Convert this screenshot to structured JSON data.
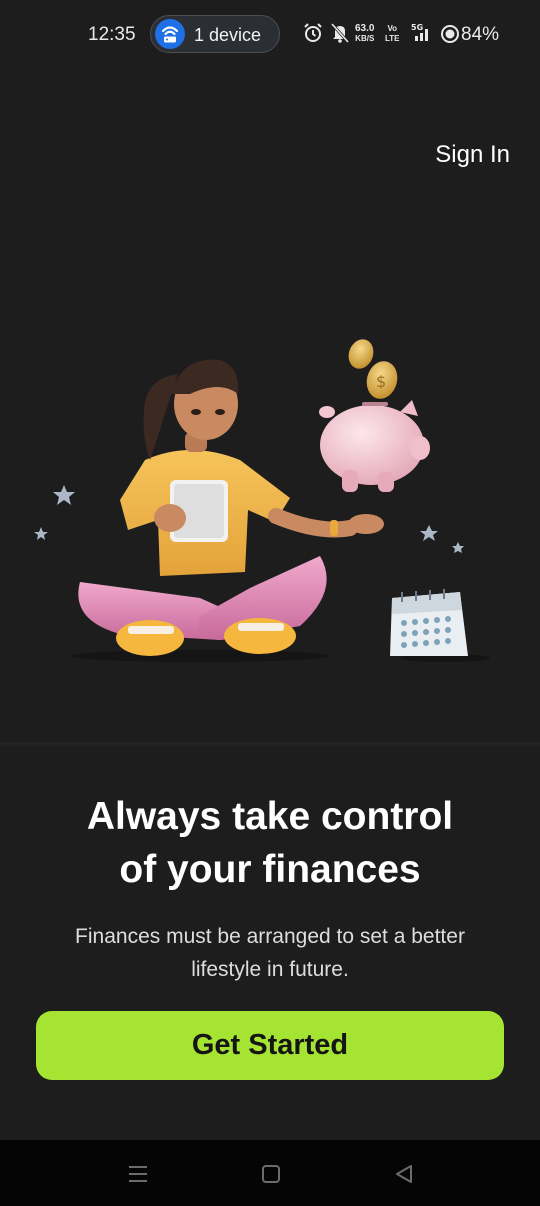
{
  "status_bar": {
    "time": "12:35",
    "hotspot_label": "1 device",
    "net_speed_value": "63.0",
    "net_speed_unit": "KB/S",
    "volte_top": "Vo",
    "volte_bottom": "LTE",
    "signal_label": "5G",
    "battery": "84%"
  },
  "header": {
    "sign_in": "Sign In"
  },
  "onboarding": {
    "headline_line1": "Always take control",
    "headline_line2": "of your finances",
    "subtext_line1": "Finances must be arranged to set a better",
    "subtext_line2": "lifestyle in future.",
    "cta": "Get Started"
  },
  "colors": {
    "background": "#1d1d1d",
    "accent": "#a6e433",
    "hotspot_blue": "#1f6fe6"
  },
  "icons": [
    "hotspot-icon",
    "alarm-icon",
    "mute-icon",
    "signal-icon",
    "battery-icon",
    "menu-icon",
    "home-icon",
    "back-icon"
  ]
}
